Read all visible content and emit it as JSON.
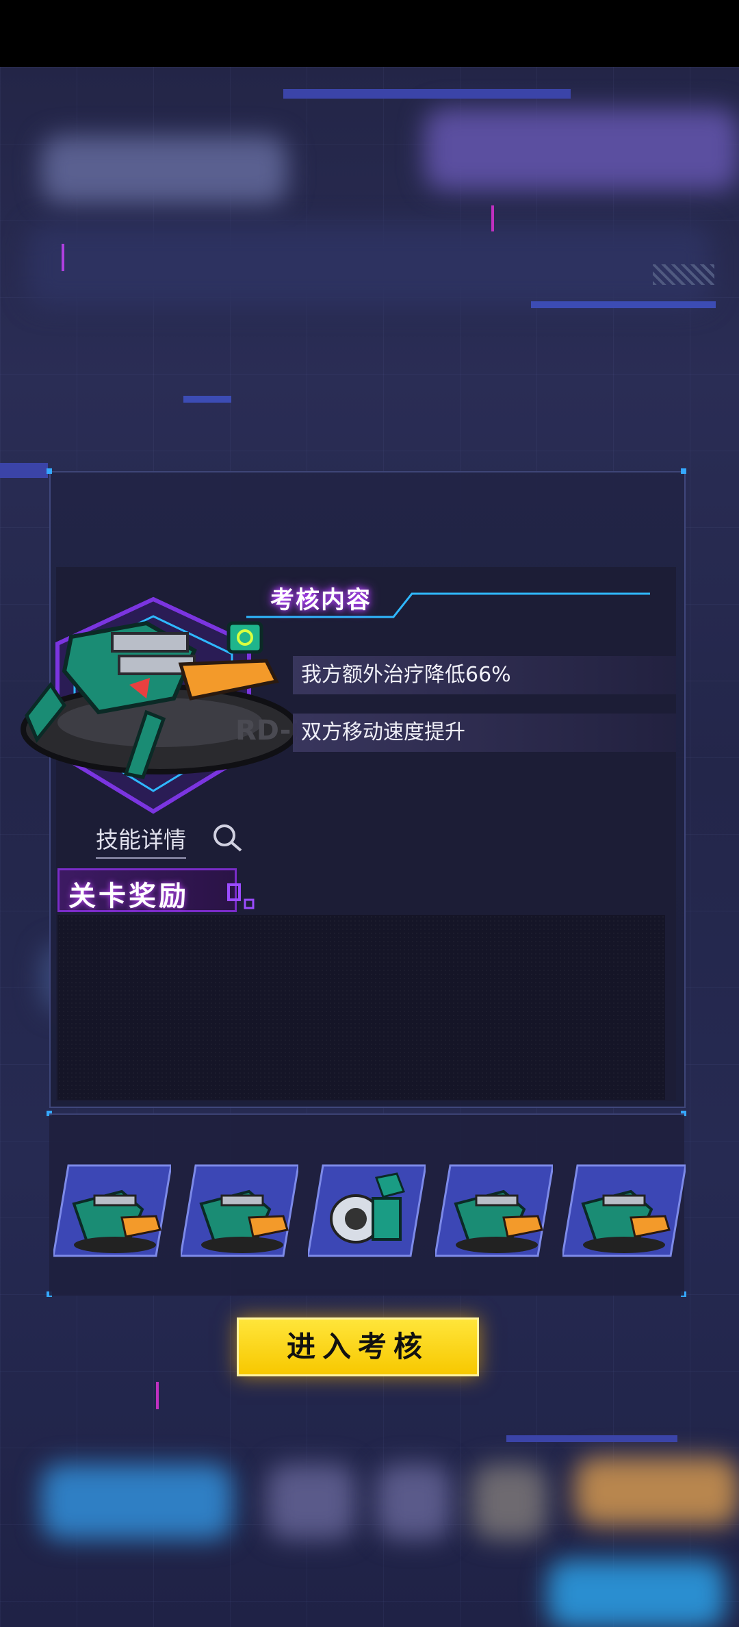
{
  "assessment": {
    "header": "考核内容",
    "conditions": [
      "我方额外治疗降低66%",
      "双方移动速度提升"
    ],
    "skill_link": "技能详情"
  },
  "rewards": {
    "title": "关卡奖励",
    "items": [
      {
        "icon": "mech-unit-icon"
      },
      {
        "icon": "mech-unit-icon"
      },
      {
        "icon": "cannon-part-icon"
      },
      {
        "icon": "mech-unit-icon"
      },
      {
        "icon": "mech-unit-icon"
      }
    ]
  },
  "enter_button": "进入考核",
  "colors": {
    "accent_yellow": "#f7c800",
    "accent_purple": "#b441ff",
    "accent_cyan": "#35a8ff"
  }
}
